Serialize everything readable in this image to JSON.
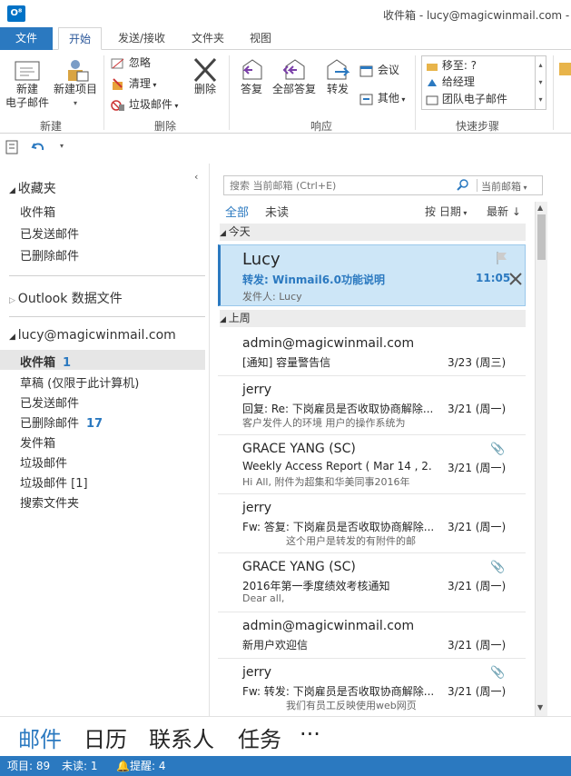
{
  "window": {
    "title": "收件箱 - lucy@magicwinmail.com - O",
    "app_icon": "O⁸"
  },
  "tabs": [
    "文件",
    "开始",
    "发送/接收",
    "文件夹",
    "视图"
  ],
  "ribbon": {
    "new_group": {
      "new_email": "新建\n电子邮件",
      "new_items": "新建项目",
      "label": "新建"
    },
    "delete_group": {
      "ignore": "忽略",
      "clean": "清理",
      "junk": "垃圾邮件",
      "delete": "删除",
      "label": "删除"
    },
    "respond_group": {
      "reply": "答复",
      "reply_all": "全部答复",
      "forward": "转发",
      "meeting": "会议",
      "more": "其他",
      "label": "响应"
    },
    "quick_steps": {
      "move_to": "移至: ?",
      "to_manager": "给经理",
      "team_email": "团队电子邮件",
      "label": "快速步骤"
    }
  },
  "nav": {
    "favorites_header": "收藏夹",
    "favorites": [
      "收件箱",
      "已发送邮件",
      "已删除邮件"
    ],
    "outlook_data": "Outlook 数据文件",
    "account": "lucy@magicwinmail.com",
    "folders": [
      {
        "name": "收件箱",
        "count": "1"
      },
      {
        "name": "草稿 (仅限于此计算机)",
        "count": ""
      },
      {
        "name": "已发送邮件",
        "count": ""
      },
      {
        "name": "已删除邮件",
        "count": "17"
      },
      {
        "name": "发件箱",
        "count": ""
      },
      {
        "name": "垃圾邮件",
        "count": ""
      },
      {
        "name": "垃圾邮件 [1]",
        "count": ""
      },
      {
        "name": "搜索文件夹",
        "count": ""
      }
    ]
  },
  "search": {
    "placeholder": "搜索 当前邮箱 (Ctrl+E)",
    "scope": "当前邮箱"
  },
  "filter": {
    "all": "全部",
    "unread": "未读",
    "by_date": "按 日期",
    "newest": "最新"
  },
  "sections": {
    "today": "今天",
    "last_week": "上周"
  },
  "mails": [
    {
      "sender": "Lucy",
      "subject": "转发: Winmail6.0功能说明",
      "preview": "发件人: Lucy",
      "date": "11:05",
      "attachment": false
    },
    {
      "sender": "admin@magicwinmail.com",
      "subject": "[通知] 容量警告信",
      "preview": "",
      "date": "3/23 (周三)",
      "attachment": false
    },
    {
      "sender": "jerry",
      "subject": "回复: Re: 下岗雇员是否收取协商解除...",
      "preview": "客户发件人的环境  用户的操作系统为",
      "date": "3/21 (周一)",
      "attachment": false
    },
    {
      "sender": "GRACE YANG (SC)",
      "subject": "Weekly Access Report ( Mar 14 , 2...",
      "preview": "Hi All,  附件为超集和华美同事2016年",
      "date": "3/21 (周一)",
      "attachment": true
    },
    {
      "sender": "jerry",
      "subject": "Fw: 答复: 下岗雇员是否收取协商解除...",
      "preview": "这个用户是转发的有附件的邮",
      "date": "3/21 (周一)",
      "attachment": false
    },
    {
      "sender": "GRACE YANG (SC)",
      "subject": "2016年第一季度绩效考核通知",
      "preview": "Dear all,",
      "date": "3/21 (周一)",
      "attachment": true
    },
    {
      "sender": "admin@magicwinmail.com",
      "subject": "新用户欢迎信",
      "preview": "",
      "date": "3/21 (周一)",
      "attachment": false
    },
    {
      "sender": "jerry",
      "subject": "Fw: 转发: 下岗雇员是否收取协商解除...",
      "preview": "我们有员工反映使用web网页",
      "date": "3/21 (周一)",
      "attachment": true
    }
  ],
  "bottom_nav": [
    "邮件",
    "日历",
    "联系人",
    "任务",
    "···"
  ],
  "status": {
    "items": "项目: 89",
    "unread": "未读: 1",
    "reminders": "提醒: 4"
  },
  "colors": {
    "accent": "#2b79c0",
    "selected_mail": "#cde6f7"
  }
}
